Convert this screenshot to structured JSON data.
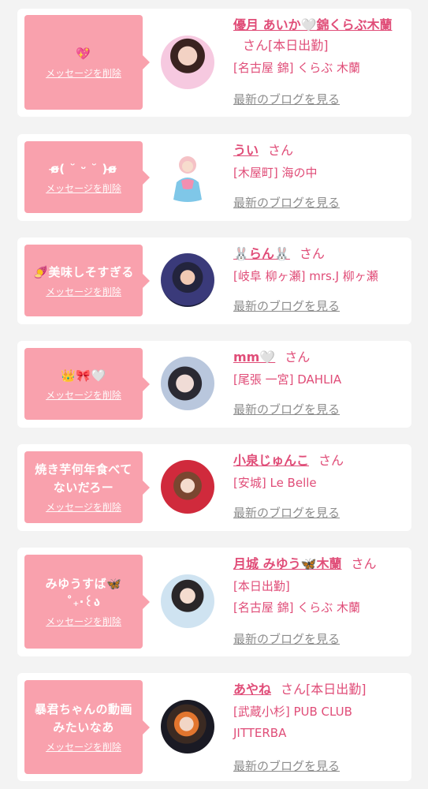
{
  "colors": {
    "accent": "#e04d78",
    "bubble": "#f9a1ad",
    "card": "#ffffff",
    "background": "#f3f3f3",
    "muted": "#8c8c8c"
  },
  "entries": [
    {
      "message": "💖",
      "delete_label": "メッセージを削除",
      "name": "優月 あいか🤍錦くらぶ木蘭",
      "suffix": "さん",
      "status": "[本日出勤]",
      "store": "[名古屋 錦] くらぶ 木蘭",
      "blog_label": "最新のブログを見る"
    },
    {
      "message": "ɞ̴̶̷( ˘ ᵕ ˘ )ɞ̴̶̷",
      "delete_label": "メッセージを削除",
      "name": "うい",
      "suffix": "さん",
      "store": "[木屋町] 海の中",
      "blog_label": "最新のブログを見る"
    },
    {
      "message": "🍠美味しそすぎる",
      "delete_label": "メッセージを削除",
      "name": "🐰らん🐰",
      "suffix": "さん",
      "store": "[岐阜 柳ヶ瀬] mrs.J 柳ヶ瀬",
      "blog_label": "最新のブログを見る"
    },
    {
      "message": "👑🎀🤍",
      "delete_label": "メッセージを削除",
      "name": "mm🤍",
      "suffix": "さん",
      "store": "[尾張 一宮] DAHLIA",
      "blog_label": "最新のブログを見る"
    },
    {
      "message_line1": "焼き芋何年食べて",
      "message_line2": "ないだろー",
      "delete_label": "メッセージを削除",
      "name": "小泉じゅんこ",
      "suffix": "さん",
      "store": "[安城] Le Belle",
      "blog_label": "最新のブログを見る"
    },
    {
      "message_line1": "みゆうすば🦋",
      "message_line2": "˚₊‧꒰ა",
      "delete_label": "メッセージを削除",
      "name": "月城 みゆう🦋木蘭",
      "suffix": "さん",
      "status": "[本日出勤]",
      "store": "[名古屋 錦] くらぶ 木蘭",
      "blog_label": "最新のブログを見る"
    },
    {
      "message_line1": "暴君ちゃんの動画",
      "message_line2": "みたいなあ",
      "delete_label": "メッセージを削除",
      "name": "あやね",
      "suffix": "さん",
      "status": "[本日出勤]",
      "store_line1": "[武蔵小杉] PUB CLUB",
      "store_line2": "JITTERBA",
      "blog_label": "最新のブログを見る"
    }
  ]
}
